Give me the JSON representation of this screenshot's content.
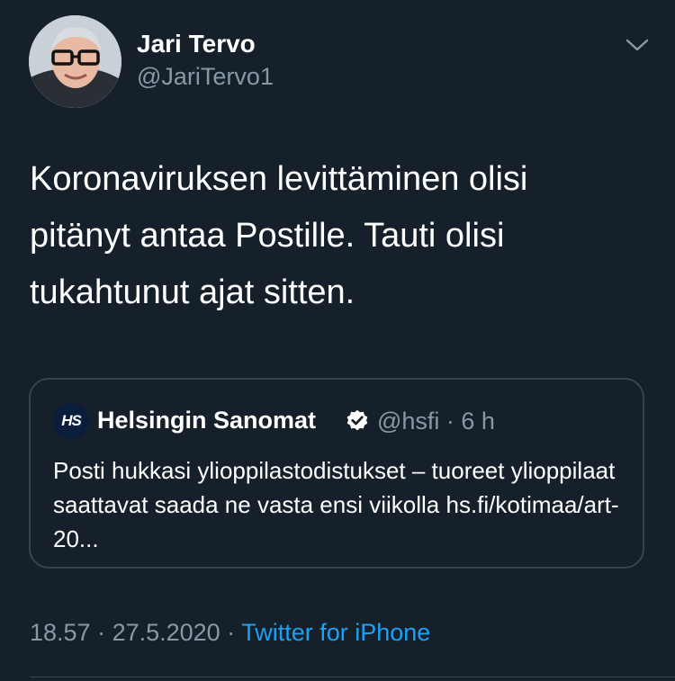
{
  "author": {
    "display_name": "Jari Tervo",
    "handle": "@JariTervo1"
  },
  "tweet": {
    "text": "Koronaviruksen levittäminen olisi pitänyt antaa Postille. Tauti olisi tukahtunut ajat sitten."
  },
  "quoted_tweet": {
    "logo_text": "HS",
    "display_name": "Helsingin Sanomat",
    "handle_time": "@hsfi · 6 h",
    "text": "Posti hukkasi ylioppilastodistukset – tuoreet ylioppilaat saattavat saada ne vasta ensi viikolla hs.fi/kotimaa/art-20..."
  },
  "meta": {
    "time": "18.57",
    "separator": " · ",
    "date": "27.5.2020",
    "source": "Twitter for iPhone"
  },
  "icons": {
    "more": "chevron-down-icon",
    "verified": "verified-badge-icon"
  },
  "colors": {
    "background": "#15202b",
    "secondary_text": "#8899a6",
    "link": "#1da1f2",
    "border": "#38444d"
  }
}
